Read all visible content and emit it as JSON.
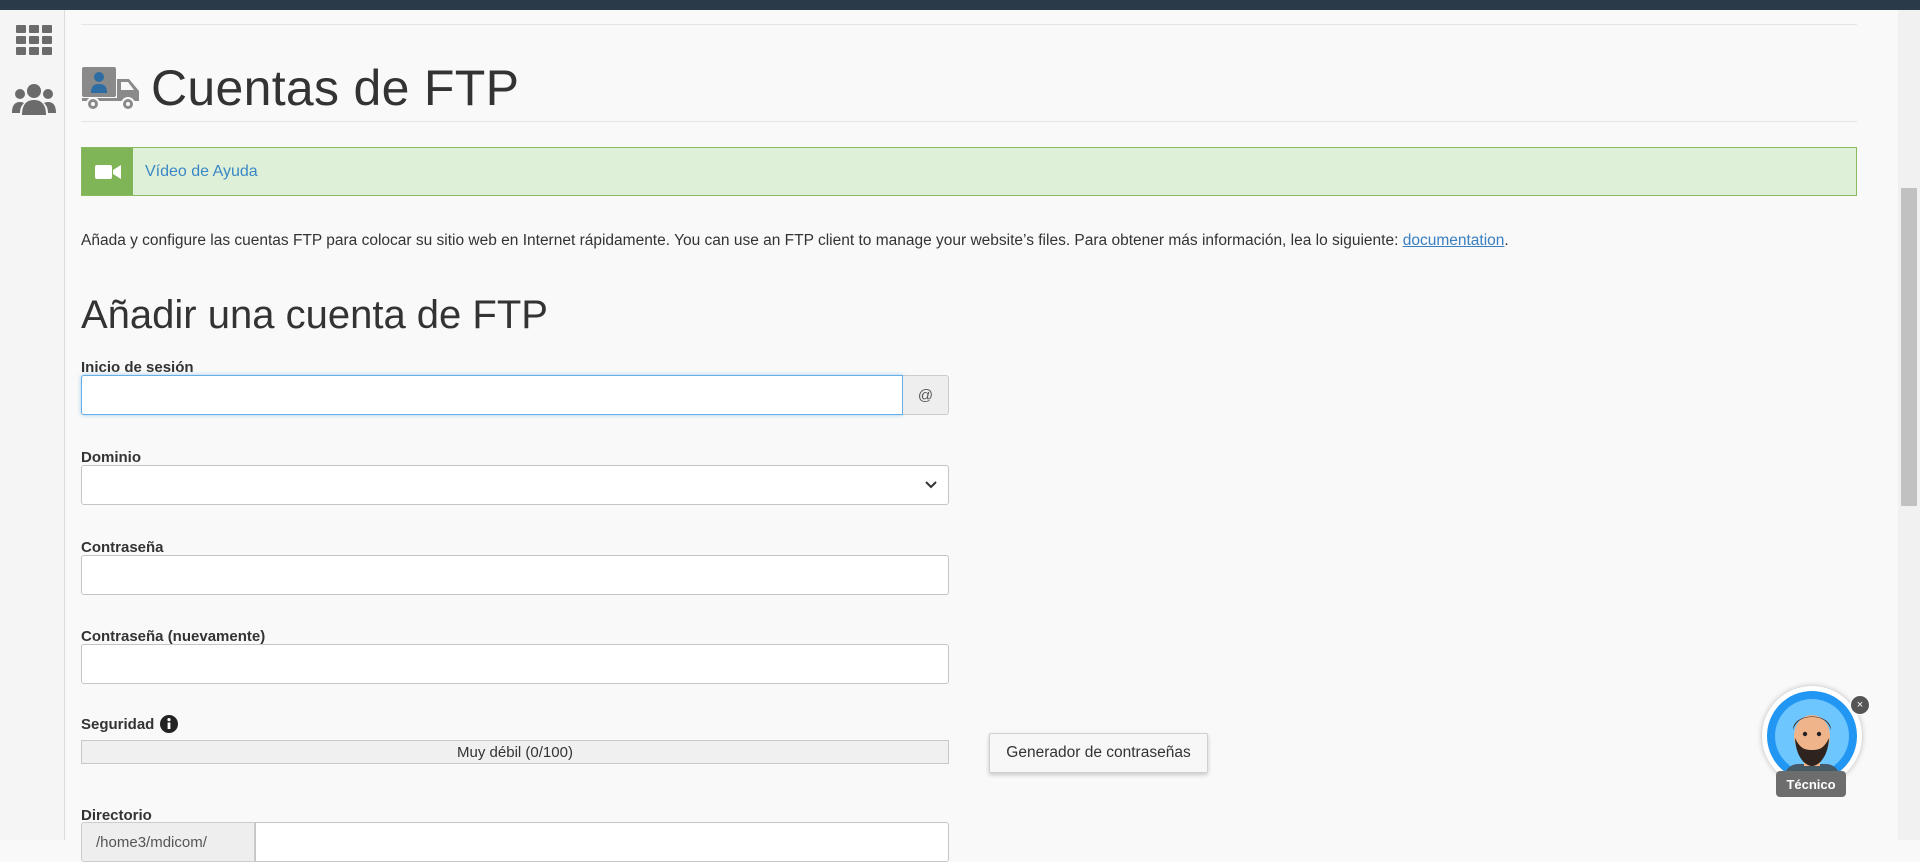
{
  "page": {
    "title": "Cuentas de FTP",
    "help_video_label": "Vídeo de Ayuda",
    "intro": {
      "text": "Añada y configure las cuentas FTP para colocar su sitio web en Internet rápidamente. You can use an FTP client to manage your website’s files. Para obtener más información, lea lo siguiente: ",
      "link_label": "documentation",
      "trailing": "."
    }
  },
  "form": {
    "section_title": "Añadir una cuenta de FTP",
    "login": {
      "label": "Inicio de sesión",
      "value": "",
      "addon": "@"
    },
    "domain": {
      "label": "Dominio",
      "value": ""
    },
    "password": {
      "label": "Contraseña",
      "value": ""
    },
    "password_again": {
      "label": "Contraseña (nuevamente)",
      "value": ""
    },
    "security": {
      "label": "Seguridad",
      "strength_text": "Muy débil (0/100)",
      "strength_value": 0
    },
    "generator_button": "Generador de contraseñas",
    "directory": {
      "label": "Directorio",
      "prefix": "/home3/mdicom/"
    }
  },
  "chat_widget": {
    "label": "Técnico",
    "close": "×"
  },
  "icons": {
    "sidebar": [
      "grid-icon",
      "users-icon"
    ],
    "title": "ftp-truck-icon",
    "help": "video-camera-icon",
    "security_info": "info-icon",
    "select": "chevron-down-icon"
  },
  "colors": {
    "topbar": "#2b3a48",
    "help_bg": "#dff0d8",
    "help_accent": "#7fb557",
    "link": "#3a7fc1"
  }
}
